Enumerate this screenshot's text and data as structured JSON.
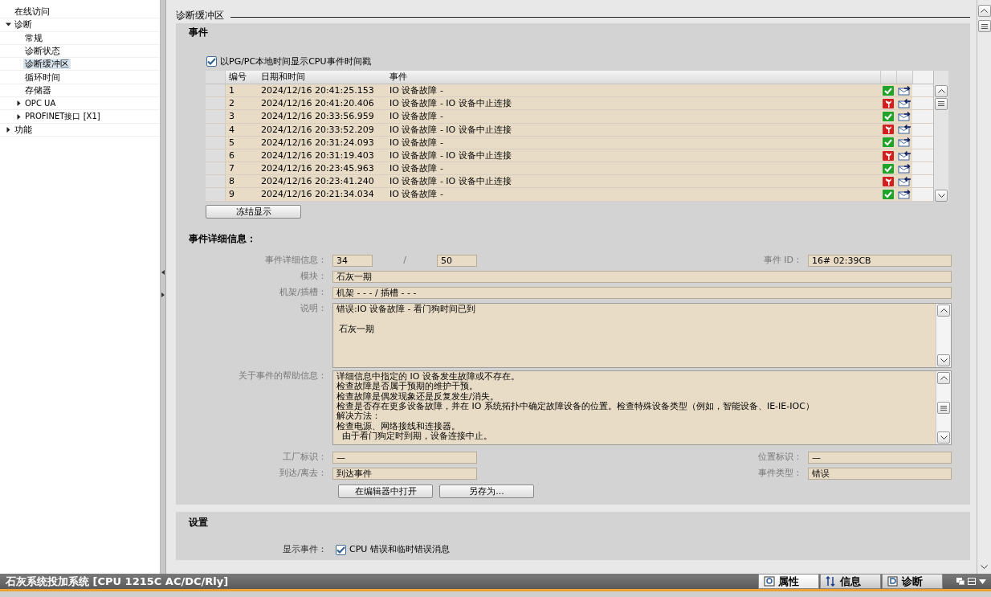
{
  "sidebar": {
    "items": [
      {
        "label": "在线访问",
        "kind": "page",
        "selected": false
      },
      {
        "label": "诊断",
        "kind": "group",
        "expanded": true,
        "selected": false,
        "children": [
          {
            "label": "常规",
            "kind": "page",
            "selected": false
          },
          {
            "label": "诊断状态",
            "kind": "page",
            "selected": false
          },
          {
            "label": "诊断缓冲区",
            "kind": "page",
            "selected": true
          },
          {
            "label": "循环时间",
            "kind": "page",
            "selected": false
          },
          {
            "label": "存储器",
            "kind": "page",
            "selected": false
          },
          {
            "label": "OPC UA",
            "kind": "group",
            "expanded": false,
            "selected": false
          },
          {
            "label": "PROFINET接口 [X1]",
            "kind": "group",
            "expanded": false,
            "selected": false
          }
        ]
      },
      {
        "label": "功能",
        "kind": "group",
        "expanded": false,
        "selected": false
      }
    ]
  },
  "page_title": "诊断缓冲区",
  "events": {
    "heading": "事件",
    "local_time": {
      "label": "以PG/PC本地时间显示CPU事件时间戳",
      "checked": true
    },
    "table": {
      "columns": [
        "编号",
        "日期和时间",
        "事件"
      ],
      "rows": [
        {
          "no": "1",
          "datetime": "2024/12/16 20:41:25.153",
          "event": "IO 设备故障 -",
          "kind": "ok"
        },
        {
          "no": "2",
          "datetime": "2024/12/16 20:41:20.406",
          "event": "IO 设备故障 - IO 设备中止连接",
          "kind": "error"
        },
        {
          "no": "3",
          "datetime": "2024/12/16 20:33:56.959",
          "event": "IO 设备故障 -",
          "kind": "ok"
        },
        {
          "no": "4",
          "datetime": "2024/12/16 20:33:52.209",
          "event": "IO 设备故障 - IO 设备中止连接",
          "kind": "error"
        },
        {
          "no": "5",
          "datetime": "2024/12/16 20:31:24.093",
          "event": "IO 设备故障 -",
          "kind": "ok"
        },
        {
          "no": "6",
          "datetime": "2024/12/16 20:31:19.403",
          "event": "IO 设备故障 - IO 设备中止连接",
          "kind": "error"
        },
        {
          "no": "7",
          "datetime": "2024/12/16 20:23:45.963",
          "event": "IO 设备故障 -",
          "kind": "ok"
        },
        {
          "no": "8",
          "datetime": "2024/12/16 20:23:41.240",
          "event": "IO 设备故障 - IO 设备中止连接",
          "kind": "error"
        },
        {
          "no": "9",
          "datetime": "2024/12/16 20:21:34.034",
          "event": "IO 设备故障 -",
          "kind": "ok"
        }
      ]
    },
    "freeze_button": "冻结显示"
  },
  "details": {
    "heading": "事件详细信息：",
    "detail_label": "事件详细信息：",
    "detail_index": "34",
    "detail_separator": "/",
    "detail_total": "50",
    "event_id_label": "事件 ID：",
    "event_id": "16# 02:39CB",
    "module_label": "模块：",
    "module": "石灰一期",
    "rack_label": "机架/插槽：",
    "rack": "机架 - - - / 插槽 - - -",
    "description_label": "说明：",
    "description": [
      "错误:IO 设备故障 - 看门狗时间已到",
      " 石灰一期"
    ],
    "help_label": "关于事件的帮助信息：",
    "help": [
      "详细信息中指定的 IO 设备发生故障或不存在。",
      "检查故障是否属于预期的维护干预。",
      "检查故障是偶发现象还是反复发生/消失。",
      "检查是否存在更多设备故障，并在 IO 系统拓扑中确定故障设备的位置。检查特殊设备类型（例如，智能设备、IE-IE-IOC）",
      "解决方法：",
      "检查电源、网络接线和连接器。",
      "  由于看门狗定时到期，设备连接中止。"
    ],
    "plant_label": "工厂标识：",
    "plant": "—",
    "location_label": "位置标识：",
    "location": "—",
    "arrival_label": "到达/离去：",
    "arrival": "到达事件",
    "type_label": "事件类型：",
    "type": "错误",
    "buttons": [
      "在编辑器中打开",
      "另存为..."
    ]
  },
  "settings": {
    "heading": "设置",
    "show_label": "显示事件：",
    "show_option": {
      "label": "CPU 错误和临时错误消息",
      "checked": true
    }
  },
  "status_bar": {
    "title": "石灰系统投加系统 [CPU 1215C AC/DC/Rly]",
    "tabs": [
      {
        "label": "属性",
        "selected": true
      },
      {
        "label": "信息",
        "selected": false
      },
      {
        "label": "诊断",
        "selected": false
      }
    ]
  }
}
